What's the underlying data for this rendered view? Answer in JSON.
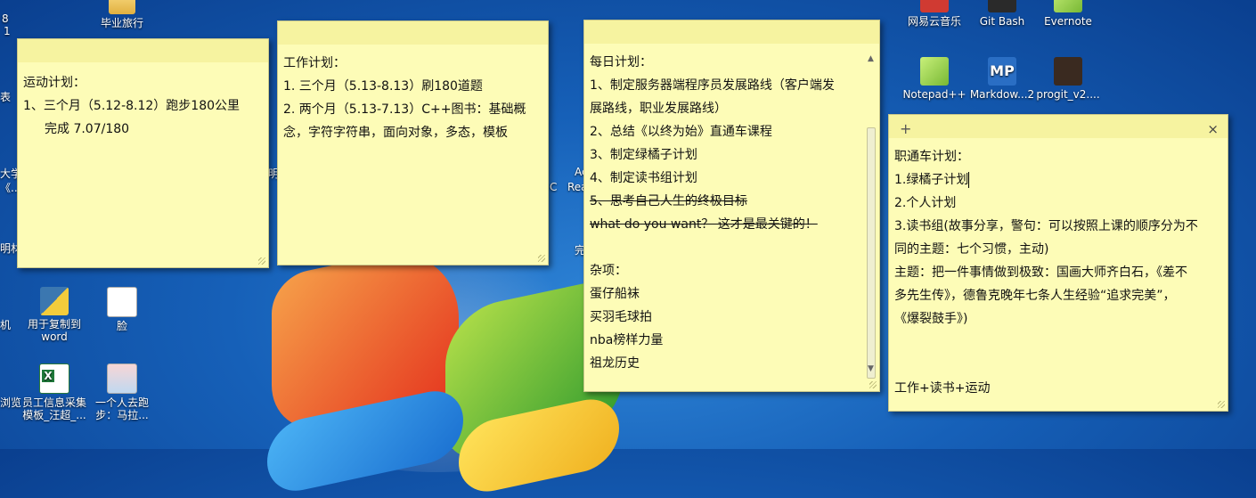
{
  "desktop_icons": [
    {
      "label": "毕业旅行",
      "icon": "folder-icon"
    },
    {
      "label": "用于复制到word",
      "icon": "python-file-icon"
    },
    {
      "label": "脸",
      "icon": "text-file-icon"
    },
    {
      "label": "员工信息采集模板_汪超_...",
      "icon": "excel-file-icon"
    },
    {
      "label": "一个人去跑步：马拉...",
      "icon": "image-file-icon"
    },
    {
      "label": "网易云音乐",
      "icon": "netease-music-icon"
    },
    {
      "label": "Git Bash",
      "icon": "git-bash-icon"
    },
    {
      "label": "Evernote",
      "icon": "evernote-icon"
    },
    {
      "label": "Notepad++",
      "icon": "notepad-plus-plus-icon"
    },
    {
      "label": "Markdow...2",
      "icon": "markdownpad-icon"
    },
    {
      "label": "progit_v2....",
      "icon": "pdf-file-icon"
    }
  ],
  "edge_text": {
    "top_left": "8",
    "top_left2": "1",
    "left_1": "表",
    "left_2": "大学",
    "left_3": "《...",
    "left_4": "明材",
    "left_5": "机",
    "left_6": "浏览",
    "mid_1": "明",
    "mid_2": "C",
    "mid_3": "Ac",
    "mid_4": "Rea",
    "mid_5": "完"
  },
  "notes": {
    "sport": {
      "lines": [
        "运动计划：",
        "1、三个月（5.12-8.12）跑步180公里",
        "完成  7.07/180"
      ]
    },
    "work": {
      "lines": [
        "工作计划：",
        "1.  三个月（5.13-8.13）刷180道题",
        "2. 两个月（5.13-7.13）C++图书：基础概",
        "念，字符字符串，面向对象，多态，模板"
      ]
    },
    "daily": {
      "lines": [
        "每日计划：",
        "1、制定服务器端程序员发展路线（客户端发",
        "展路线，职业发展路线）",
        "2、总结《以终为始》直通车课程",
        "3、制定绿橘子计划",
        "4、制定读书组计划",
        "5、思考自己人生的终极目标",
        "what do you want？ 这才是最关键的！",
        "",
        "杂项：",
        "蛋仔船袜",
        "买羽毛球拍",
        "nba榜样力量",
        "祖龙历史"
      ]
    },
    "career": {
      "plus": "+",
      "close": "×",
      "lines": [
        "职通车计划：",
        "1.绿橘子计划",
        "2.个人计划",
        "3.读书组(故事分享，警句：可以按照上课的顺序分为不",
        "同的主题：七个习惯，主动)",
        "主题：把一件事情做到极致：国画大师齐白石，《差不",
        "多先生传》，德鲁克晚年七条人生经验“追求完美”，",
        "《爆裂鼓手》)",
        "",
        "",
        "工作+读书+运动"
      ]
    }
  }
}
